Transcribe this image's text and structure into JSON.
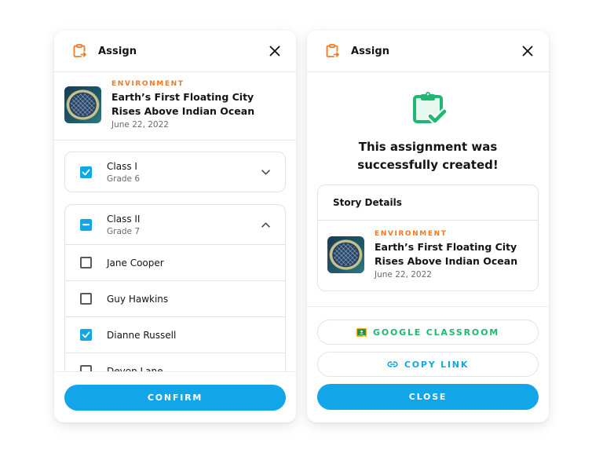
{
  "colors": {
    "accent_orange": "#f07a24",
    "primary_blue": "#12a5e8",
    "success_green": "#1fb872"
  },
  "left_panel": {
    "header": {
      "icon": "clipboard-assign-icon",
      "title": "Assign",
      "close_icon": "close-icon"
    },
    "story": {
      "category": "ENVIRONMENT",
      "title": "Earth’s First Floating City Rises Above Indian Ocean",
      "date": "June 22, 2022",
      "thumbnail": "floating-city-thumbnail"
    },
    "classes": [
      {
        "name": "Class I",
        "grade": "Grade 6",
        "state": "checked",
        "expanded": false,
        "chevron": "chevron-down-icon"
      },
      {
        "name": "Class II",
        "grade": "Grade 7",
        "state": "indeterminate",
        "expanded": true,
        "chevron": "chevron-up-icon",
        "students": [
          {
            "name": "Jane Cooper",
            "checked": false
          },
          {
            "name": "Guy Hawkins",
            "checked": false
          },
          {
            "name": "Dianne Russell",
            "checked": true
          },
          {
            "name": "Devon Lane",
            "checked": false
          }
        ]
      }
    ],
    "confirm_label": "CONFIRM"
  },
  "right_panel": {
    "header": {
      "icon": "clipboard-assign-icon",
      "title": "Assign",
      "close_icon": "close-icon"
    },
    "success_icon": "clipboard-check-icon",
    "success_message_line1": "This assignment was",
    "success_message_line2": "successfully created!",
    "details_title": "Story Details",
    "story": {
      "category": "ENVIRONMENT",
      "title": "Earth’s First Floating City Rises Above Indian Ocean",
      "date": "June 22, 2022",
      "thumbnail": "floating-city-thumbnail"
    },
    "google_classroom_label": "GOOGLE CLASSROOM",
    "copy_link_label": "COPY LINK",
    "close_label": "CLOSE"
  }
}
